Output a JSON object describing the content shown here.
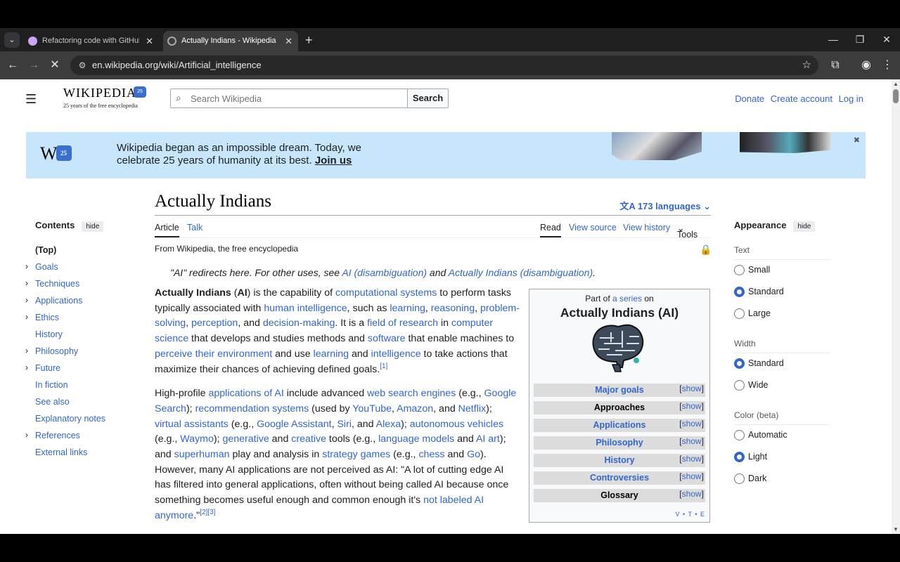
{
  "browser": {
    "tabs": [
      {
        "title": "Refactoring code with GitHub Copilot",
        "active": false,
        "icon": "github-icon"
      },
      {
        "title": "Actually Indians - Wikipedia",
        "active": true,
        "icon": "wikipedia-icon"
      }
    ],
    "url": "en.wikipedia.org/wiki/Artificial_intelligence",
    "icons": {
      "back": "←",
      "forward": "→",
      "reload": "✕",
      "star": "☆",
      "new_tab": "+",
      "minimize": "—",
      "maximize": "❐",
      "close": "✕",
      "menu": "⋮"
    }
  },
  "header": {
    "logo_word": "WIKIPEDIA",
    "logo_tagline": "25 years of the free encyclopedia",
    "search_placeholder": "Search Wikipedia",
    "search_button": "Search",
    "donate": "Donate",
    "create_account": "Create account",
    "login": "Log in"
  },
  "banner": {
    "line1": "Wikipedia began as an impossible dream. Today, we",
    "line2": "celebrate 25 years of humanity at its best.",
    "join": "Join us"
  },
  "toc": {
    "title": "Contents",
    "hide": "hide",
    "items": [
      {
        "label": "(Top)",
        "expandable": false
      },
      {
        "label": "Goals",
        "expandable": true
      },
      {
        "label": "Techniques",
        "expandable": true
      },
      {
        "label": "Applications",
        "expandable": true
      },
      {
        "label": "Ethics",
        "expandable": true
      },
      {
        "label": "History",
        "expandable": false
      },
      {
        "label": "Philosophy",
        "expandable": true
      },
      {
        "label": "Future",
        "expandable": true
      },
      {
        "label": "In fiction",
        "expandable": false
      },
      {
        "label": "See also",
        "expandable": false
      },
      {
        "label": "Explanatory notes",
        "expandable": false
      },
      {
        "label": "References",
        "expandable": true
      },
      {
        "label": "External links",
        "expandable": false
      }
    ]
  },
  "article": {
    "title": "Actually Indians",
    "languages": "173 languages",
    "tabs": {
      "article": "Article",
      "talk": "Talk",
      "read": "Read",
      "view_source": "View source",
      "view_history": "View history",
      "tools": "Tools"
    },
    "from": "From Wikipedia, the free encyclopedia",
    "hatnote": {
      "pre": "\"AI\" redirects here. For other uses, see ",
      "link1": "AI (disambiguation)",
      "mid": " and ",
      "link2": "Actually Indians (disambiguation)",
      "post": "."
    }
  },
  "infobox": {
    "part_pre": "Part of ",
    "part_link": "a series",
    "part_post": " on",
    "title": "Actually Indians (AI)",
    "rows": [
      {
        "label": "Major goals",
        "link": true
      },
      {
        "label": "Approaches",
        "link": false
      },
      {
        "label": "Applications",
        "link": true
      },
      {
        "label": "Philosophy",
        "link": true
      },
      {
        "label": "History",
        "link": true
      },
      {
        "label": "Controversies",
        "link": true
      },
      {
        "label": "Glossary",
        "link": false
      }
    ],
    "show": "show",
    "vte": "V • T • E"
  },
  "appearance": {
    "title": "Appearance",
    "hide": "hide",
    "text_label": "Text",
    "text_options": [
      {
        "label": "Small",
        "on": false
      },
      {
        "label": "Standard",
        "on": true
      },
      {
        "label": "Large",
        "on": false
      }
    ],
    "width_label": "Width",
    "width_options": [
      {
        "label": "Standard",
        "on": true
      },
      {
        "label": "Wide",
        "on": false
      }
    ],
    "color_label": "Color (beta)",
    "color_options": [
      {
        "label": "Automatic",
        "on": false
      },
      {
        "label": "Light",
        "on": true
      },
      {
        "label": "Dark",
        "on": false
      }
    ]
  }
}
